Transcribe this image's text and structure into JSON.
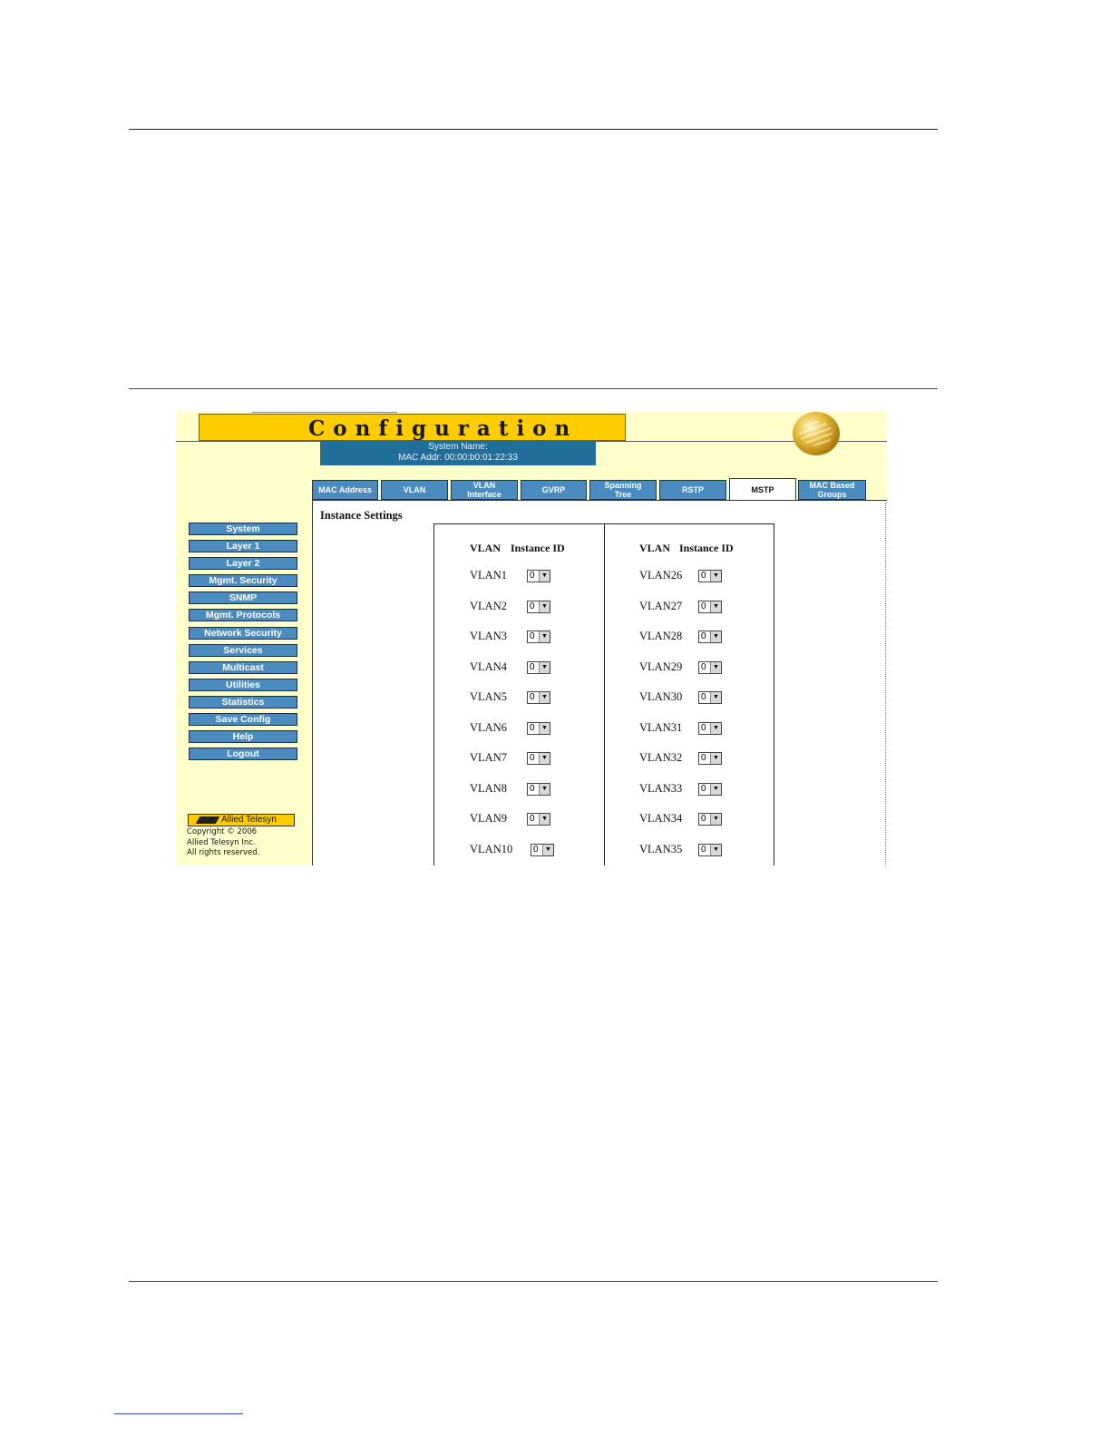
{
  "header": {
    "title": "Configuration",
    "system_name_label": "System Name:",
    "mac_addr_label": "MAC Addr:",
    "mac_addr_value": "00:00:b0:01:22:33"
  },
  "tabs": [
    {
      "label": "MAC Address"
    },
    {
      "label": "VLAN"
    },
    {
      "label": "VLAN Interface"
    },
    {
      "label": "GVRP"
    },
    {
      "label": "Spanning Tree"
    },
    {
      "label": "RSTP"
    },
    {
      "label": "MSTP",
      "active": true
    },
    {
      "label": "MAC Based Groups"
    }
  ],
  "nav": [
    "System",
    "Layer 1",
    "Layer 2",
    "Mgmt. Security",
    "SNMP",
    "Mgmt. Protocols",
    "Network Security",
    "Services",
    "Multicast",
    "Utilities",
    "Statistics",
    "Save Config",
    "Help",
    "Logout"
  ],
  "logo_text": "Allied Telesyn",
  "copyright": [
    "Copyright © 2006",
    "Allied Telesyn Inc.",
    "All rights reserved."
  ],
  "content": {
    "section_title": "Instance Settings",
    "col_header_vlan": "VLAN",
    "col_header_instance": "Instance ID",
    "left_rows": [
      {
        "vlan": "VLAN1",
        "instance": "0"
      },
      {
        "vlan": "VLAN2",
        "instance": "0"
      },
      {
        "vlan": "VLAN3",
        "instance": "0"
      },
      {
        "vlan": "VLAN4",
        "instance": "0"
      },
      {
        "vlan": "VLAN5",
        "instance": "0"
      },
      {
        "vlan": "VLAN6",
        "instance": "0"
      },
      {
        "vlan": "VLAN7",
        "instance": "0"
      },
      {
        "vlan": "VLAN8",
        "instance": "0"
      },
      {
        "vlan": "VLAN9",
        "instance": "0"
      },
      {
        "vlan": "VLAN10",
        "instance": "0"
      }
    ],
    "right_rows": [
      {
        "vlan": "VLAN26",
        "instance": "0"
      },
      {
        "vlan": "VLAN27",
        "instance": "0"
      },
      {
        "vlan": "VLAN28",
        "instance": "0"
      },
      {
        "vlan": "VLAN29",
        "instance": "0"
      },
      {
        "vlan": "VLAN30",
        "instance": "0"
      },
      {
        "vlan": "VLAN31",
        "instance": "0"
      },
      {
        "vlan": "VLAN32",
        "instance": "0"
      },
      {
        "vlan": "VLAN33",
        "instance": "0"
      },
      {
        "vlan": "VLAN34",
        "instance": "0"
      },
      {
        "vlan": "VLAN35",
        "instance": "0"
      }
    ]
  },
  "colors": {
    "title_bar": "#ffcc00",
    "nav_button": "#4a8cc0",
    "sysinfo_bg": "#1f6f9a",
    "frame_bg": "#ffffcc"
  }
}
